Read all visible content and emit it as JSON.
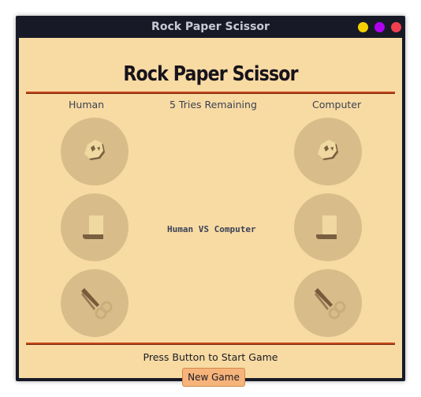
{
  "window": {
    "title": "Rock Paper Scissor"
  },
  "header": {
    "title": "Rock Paper Scissor"
  },
  "scoreboard": {
    "human_label": "Human",
    "tries_label": "5 Tries Remaining",
    "computer_label": "Computer"
  },
  "arena": {
    "versus_label": "Human VS Computer"
  },
  "choices": [
    {
      "name": "rock",
      "icon": "rock-icon"
    },
    {
      "name": "paper",
      "icon": "paper-icon"
    },
    {
      "name": "scissor",
      "icon": "scissor-icon"
    }
  ],
  "footer": {
    "status": "Press Button to Start Game",
    "new_game_label": "New Game"
  },
  "colors": {
    "background": "#f8dba3",
    "circle": "#d8bd8a",
    "accent_rule": "#c4461c",
    "button": "#f6b37a",
    "titlebar": "#171a26"
  }
}
